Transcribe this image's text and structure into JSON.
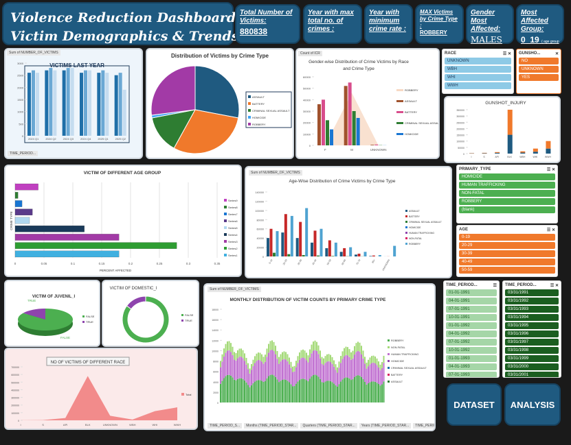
{
  "header": {
    "title_line1": "Violence Reduction Dashboard:",
    "title_line2": "Victim Demographics & Trends"
  },
  "kpis": [
    {
      "label": "Total Number of Victims:",
      "value": "880838"
    },
    {
      "label": "Year with max total no. of crimes :",
      "value": ""
    },
    {
      "label": "Year with minimum crime rate :",
      "value": ""
    },
    {
      "label": "MAX Victims by Crime Type :",
      "value": "ROBBERY"
    },
    {
      "label": "Gender Most Affected:",
      "value": "MALES"
    },
    {
      "label": "Most Affected Group:",
      "value": "0_19",
      "note": "( age group )"
    }
  ],
  "buttons": {
    "dataset": "DATASET",
    "analysis": "ANALYSIS"
  },
  "pivot_tags": {
    "sum_victims": "Sum of NUMBER_OF_VICTIMS",
    "count_victims": "Count of ICR",
    "time_filter": "TIME_PERIOD..."
  },
  "race_slicer": {
    "title": "RACE",
    "items": [
      "UNKNOWN",
      "WBH",
      "WHI",
      "WWH"
    ]
  },
  "gunshot_slicer": {
    "title": "GUNSHO...",
    "items": [
      "NO",
      "UNKNOWN",
      "YES"
    ]
  },
  "primary_type_slicer": {
    "title": "PRIMARY_TYPE",
    "items": [
      "HOMICIDE",
      "HUMAN TRAFFICKING",
      "NON-FATAL",
      "ROBBERY",
      "(blank)"
    ]
  },
  "age_slicer": {
    "title": "AGE",
    "items": [
      "0-19",
      "20-29",
      "30-39",
      "40-49",
      "50-59"
    ]
  },
  "time_slicer1": {
    "title": "TIME_PERIOD...",
    "items": [
      "01-01-1991",
      "04-01-1991",
      "07-01-1991",
      "10-01-1991",
      "01-01-1992",
      "04-01-1992",
      "07-01-1992",
      "10-01-1992",
      "01-01-1993",
      "04-01-1993",
      "07-01-1993"
    ]
  },
  "time_slicer2": {
    "title": "TIME_PERIOD...",
    "items": [
      "03/31/1991",
      "03/31/1992",
      "03/31/1993",
      "03/31/1994",
      "03/31/1995",
      "03/31/1996",
      "03/31/1997",
      "03/31/1998",
      "03/31/1999",
      "03/31/2000",
      "03/31/2001"
    ]
  },
  "bottom_filters": [
    "TIME_PERIOD_S...",
    "Months (TIME_PERIOD_STAR...",
    "Quarters (TIME_PERIOD_STAR...",
    "Years (TIME_PERIOD_STAR...",
    "TIME_PERIOD_STA..."
  ],
  "chart_data": [
    {
      "id": "victims_last_year",
      "type": "bar",
      "title": "VICTIMS LAST YEAR",
      "categories": [
        "2024 Q1",
        "2024 Q2",
        "2024 Q3",
        "2024 Q4",
        "2025 Q1",
        "2025 Q2"
      ],
      "series": [
        {
          "values": [
            2600,
            2700,
            2700,
            2600,
            2600,
            2500
          ],
          "color": "#1f6fa8"
        },
        {
          "values": [
            2700,
            2800,
            2800,
            2700,
            2700,
            2600
          ],
          "color": "#6aa8d4"
        },
        {
          "values": [
            2600,
            2700,
            2800,
            2700,
            2600,
            1900
          ],
          "color": "#c5dcef"
        }
      ],
      "ylim": [
        0,
        3000
      ],
      "yticks": [
        "0",
        "500",
        "1000",
        "1500",
        "2000",
        "2500",
        "3000"
      ]
    },
    {
      "id": "pie_crime_type",
      "type": "pie",
      "title": "Distribution of Victims by Crime Type",
      "legend": [
        "ASSAULT",
        "BATTERY",
        "CRIMINAL SEXUAL ASSAULT",
        "HOMICIDE",
        "ROBBERY"
      ],
      "values": [
        28,
        30,
        14,
        1,
        27
      ],
      "colors": [
        "#1f5a80",
        "#f0792b",
        "#2e7d32",
        "#42a5f5",
        "#a23aa6"
      ]
    },
    {
      "id": "gender_crime",
      "type": "bar",
      "title": "Gender-wise Distribution of Crime Victims by Race and Crime Type",
      "categories": [
        "F",
        "M",
        "UNKNOWN"
      ],
      "legend": [
        "ROBBERY",
        "ASSAULT",
        "BATTERY",
        "CRIMINAL SEXUAL ASSAULT",
        "HOMICIDE"
      ],
      "yticks": [
        "0",
        "10000",
        "20000",
        "30000",
        "40000",
        "50000",
        "60000"
      ],
      "series": [
        {
          "name": "ASSAULT",
          "values": [
            36000,
            52000,
            500
          ],
          "color": "#a0522d"
        },
        {
          "name": "BATTERY",
          "values": [
            40000,
            55000,
            700
          ],
          "color": "#d84d8c"
        },
        {
          "name": "CSA",
          "values": [
            22000,
            30000,
            200
          ],
          "color": "#2e7d32"
        },
        {
          "name": "HOMICIDE",
          "values": [
            14000,
            24000,
            100
          ],
          "color": "#1976d2"
        }
      ],
      "area": [
        0,
        46000,
        0
      ]
    },
    {
      "id": "gunshot",
      "type": "bar",
      "title": "GUNSHOT_INJURY",
      "categories": [
        "I",
        "S",
        "API",
        "BLK",
        "WBH",
        "WHI",
        "WWH"
      ],
      "yticks": [
        "0",
        "50000",
        "100000",
        "150000",
        "200000",
        "250000",
        "300000",
        "350000"
      ],
      "series": [
        {
          "values": [
            2000,
            3000,
            6000,
            150000,
            8000,
            15000,
            40000
          ],
          "color": "#1f5a80"
        },
        {
          "values": [
            2000,
            3000,
            6000,
            200000,
            10000,
            25000,
            60000
          ],
          "color": "#f0792b"
        }
      ]
    },
    {
      "id": "age_group",
      "type": "bar",
      "title": "VICTIM OF DIFFERENT AGE GROUP",
      "xlabel": "PERCENT AFFECTED",
      "ylabel": "CRIME TYPE",
      "xticks": [
        "0",
        "0.05",
        "0.1",
        "0.15",
        "0.2",
        "0.25",
        "0.3",
        "0.35"
      ],
      "legend": [
        "Series9",
        "Series8",
        "Series7",
        "Series6",
        "Series5",
        "Series4",
        "Series3",
        "Series2",
        "Series1"
      ],
      "values": [
        0.04,
        0.005,
        0.012,
        0.03,
        0.025,
        0.12,
        0.18,
        0.28,
        0.18
      ],
      "colors": [
        "#c040c0",
        "#2e7d32",
        "#1976d2",
        "#5a3a8a",
        "#b0d8f0",
        "#1a3a5a",
        "#a23aa6",
        "#2e9d32",
        "#40b0e0"
      ]
    },
    {
      "id": "age_wise",
      "type": "bar",
      "title": "Age-Wise Distribution of Crime Victims by Crime Type",
      "categories": [
        "0-19",
        "20-29",
        "30-39",
        "40-49",
        "50-59",
        "60-69",
        "70-79",
        "80+",
        "UNKNOWN"
      ],
      "legend": [
        "ASSAULT",
        "BATTERY",
        "CRIMINAL SEXUAL ASSAULT",
        "HOMICIDE",
        "HUMAN TRAFFICKING",
        "NON-FATAL",
        "ROBBERY"
      ],
      "yticks": [
        "0",
        "20000",
        "40000",
        "60000",
        "80000",
        "100000",
        "120000",
        "140000"
      ],
      "series": [
        {
          "name": "ASSAULT",
          "values": [
            40000,
            52000,
            40000,
            30000,
            18000,
            10000,
            4000,
            1000,
            100
          ],
          "color": "#1f5a80"
        },
        {
          "name": "BATTERY",
          "values": [
            60000,
            92000,
            75000,
            56000,
            35000,
            18000,
            6000,
            2000,
            200
          ],
          "color": "#c62828"
        },
        {
          "name": "CSA",
          "values": [
            8000,
            5000,
            3000,
            2000,
            1000,
            500,
            300,
            100,
            20
          ],
          "color": "#2e7d32"
        },
        {
          "name": "ROBBERY",
          "values": [
            55000,
            88000,
            105000,
            60000,
            30000,
            20000,
            10000,
            3000,
            23000
          ],
          "color": "#4fa3d1"
        }
      ]
    },
    {
      "id": "juvenile",
      "type": "pie",
      "title": "VICTIM OF JUVENIL_I",
      "legend": [
        "FALSE",
        "TRUE"
      ],
      "values": [
        85,
        15
      ],
      "colors": [
        "#4caf50",
        "#8e44ad"
      ]
    },
    {
      "id": "domestic",
      "type": "pie",
      "title": "VICTIM OF DOMESTIC_I",
      "legend": [
        "FALSE",
        "TRUE"
      ],
      "values": [
        85,
        15
      ],
      "colors": [
        "#4caf50",
        "#8e44ad"
      ]
    },
    {
      "id": "race_area",
      "type": "area",
      "title": "NO OF VICTIMS OF DIFFERENT RACE",
      "categories": [
        "I",
        "S",
        "API",
        "BLK",
        "UNKNOWN",
        "WBH",
        "WHI",
        "WWH"
      ],
      "legend": [
        "Total"
      ],
      "yticks": [
        "0",
        "100000",
        "200000",
        "300000",
        "400000",
        "500000",
        "600000",
        "700000"
      ],
      "values": [
        1000,
        3000,
        30000,
        580000,
        60000,
        10000,
        120000,
        170000
      ]
    },
    {
      "id": "monthly",
      "type": "bar",
      "title": "MONTHLY DISTRIBUTION OF VICTIM COUNTS BY PRIMARY CRIME TYPE",
      "legend": [
        "ROBBERY",
        "NON-FATAL",
        "HUMAN TRAFFICKING",
        "HOMICIDE",
        "CRIMINAL SEXUAL ASSAULT",
        "BATTERY",
        "ASSAULT"
      ],
      "yticks": [
        "0",
        "2000",
        "4000",
        "6000",
        "8000",
        "10000",
        "12000",
        "14000",
        "16000",
        "18000"
      ]
    }
  ]
}
